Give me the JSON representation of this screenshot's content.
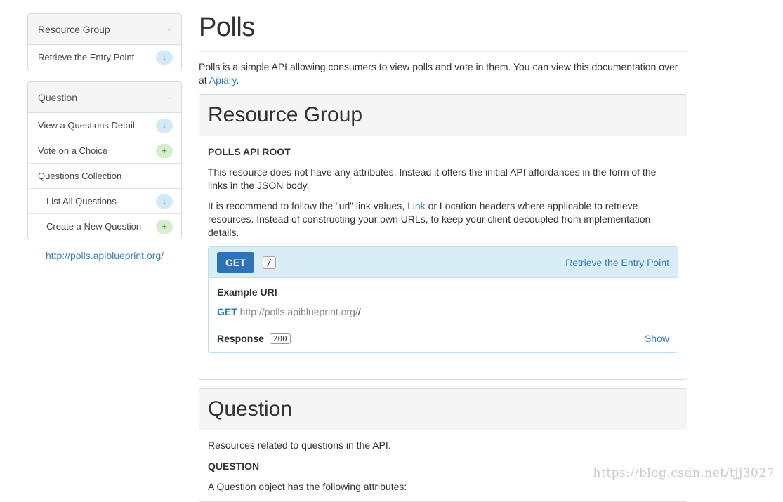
{
  "sidebar": {
    "groups": [
      {
        "heading": "Resource Group",
        "items": [
          {
            "label": "Retrieve the Entry Point",
            "icon": "arrow-down-icon"
          }
        ]
      },
      {
        "heading": "Question",
        "items": [
          {
            "label": "View a Questions Detail",
            "icon": "arrow-down-icon"
          },
          {
            "label": "Vote on a Choice",
            "icon": "plus-icon"
          },
          {
            "label": "Questions Collection",
            "icon": ""
          },
          {
            "label": "List All Questions",
            "icon": "arrow-down-icon"
          },
          {
            "label": "Create a New Question",
            "icon": "plus-icon"
          }
        ]
      }
    ],
    "host": "http://polls.apiblueprint.org/"
  },
  "main": {
    "title": "Polls",
    "intro_before": "Polls is a simple API allowing consumers to view polls and vote in them. You can view this documentation over at ",
    "intro_link": "Apiary",
    "intro_after": ".",
    "group1": {
      "heading": "Resource Group",
      "resource_title": "POLLS API ROOT",
      "para1": "This resource does not have any attributes. Instead it offers the initial API affordances in the form of the links in the JSON body.",
      "para2_before": "It is recommend to follow the “url” link values, ",
      "para2_link": "Link",
      "para2_after": " or Location headers where applicable to retrieve resources. Instead of constructing your own URLs, to keep your client decoupled from implementation details.",
      "action": {
        "method": "GET",
        "uri": "/",
        "name": "Retrieve the Entry Point",
        "example_title": "Example URI",
        "example_method": "GET",
        "example_host": "http://polls.apiblueprint.org/",
        "example_path": "/",
        "response_label": "Response",
        "response_code": "200",
        "show_label": "Show"
      }
    },
    "group2": {
      "heading": "Question",
      "para1": "Resources related to questions in the API.",
      "resource_title": "QUESTION",
      "para2": "A Question object has the following attributes:"
    }
  },
  "watermark": "https://blog.csdn.net/tjj3027",
  "colors": {
    "accent": "#2e73b5",
    "link": "#3a7fb6",
    "action_header": "#d9edf7",
    "get_badge": "#d4e9f6",
    "post_badge": "#d7edd0"
  }
}
